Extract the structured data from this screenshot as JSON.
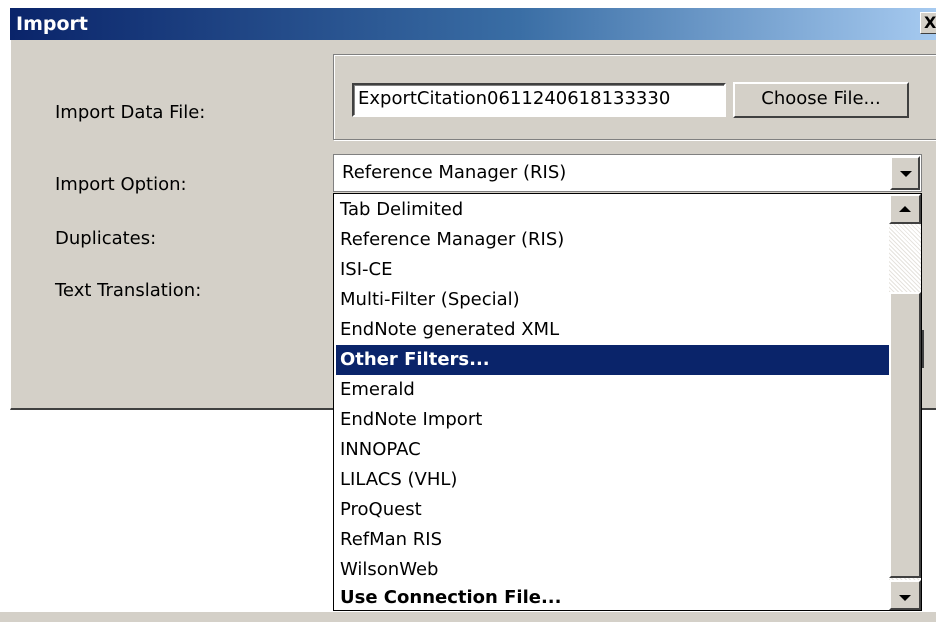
{
  "window": {
    "title": "Import",
    "close_label": "X"
  },
  "form": {
    "import_data_file_label": "Import Data File:",
    "import_option_label": "Import Option:",
    "duplicates_label": "Duplicates:",
    "text_translation_label": "Text Translation:",
    "file_value": "ExportCitation0611240618133330",
    "choose_file_label": "Choose File...",
    "selected_option": "Reference Manager (RIS)"
  },
  "dropdown": {
    "items": [
      "Tab Delimited",
      "Reference Manager (RIS)",
      "ISI-CE",
      "Multi-Filter (Special)",
      "EndNote generated XML",
      "Other Filters...",
      "Emerald",
      "EndNote Import",
      "INNOPAC",
      "LILACS (VHL)",
      "ProQuest",
      "RefMan RIS",
      "WilsonWeb",
      "Use Connection File..."
    ],
    "highlighted": "Other Filters..."
  },
  "colors": {
    "titlebar": "#0a246a",
    "dialog_bg": "#d4d0c8",
    "selection": "#0a246a"
  },
  "icons": {
    "close": "close-icon",
    "combo_arrow": "chevron-down-icon",
    "scroll_up": "arrow-up-icon",
    "scroll_down": "arrow-down-icon"
  }
}
